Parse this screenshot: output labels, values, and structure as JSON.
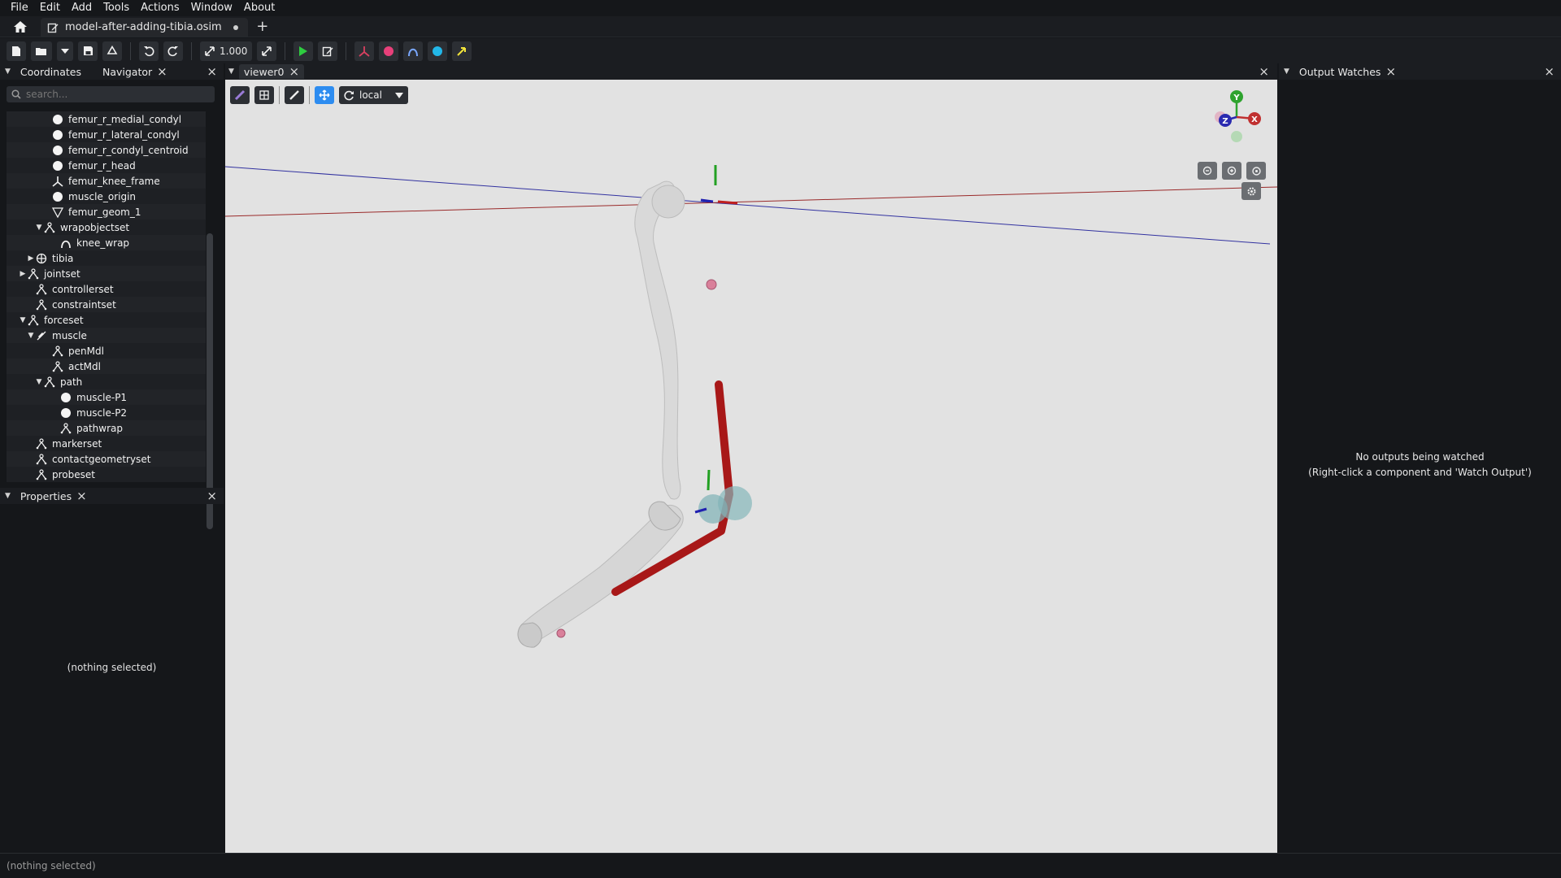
{
  "menu": [
    "File",
    "Edit",
    "Add",
    "Tools",
    "Actions",
    "Window",
    "About"
  ],
  "tabs": {
    "document_title": "model-after-adding-tibia.osim",
    "new_tab_symbol": "+"
  },
  "toolbar": {
    "scale_value": "1.000"
  },
  "navigator": {
    "coordinates_tab": "Coordinates",
    "navigator_tab": "Navigator",
    "search_placeholder": "search...",
    "tree": [
      {
        "label": "femur_r_medial_condyl",
        "indent": 5,
        "arrow": "",
        "icon": "circle"
      },
      {
        "label": "femur_r_lateral_condyl",
        "indent": 5,
        "arrow": "",
        "icon": "circle"
      },
      {
        "label": "femur_r_condyl_centroid",
        "indent": 5,
        "arrow": "",
        "icon": "circle"
      },
      {
        "label": "femur_r_head",
        "indent": 5,
        "arrow": "",
        "icon": "circle"
      },
      {
        "label": "femur_knee_frame",
        "indent": 5,
        "arrow": "",
        "icon": "frame"
      },
      {
        "label": "muscle_origin",
        "indent": 5,
        "arrow": "",
        "icon": "circle"
      },
      {
        "label": "femur_geom_1",
        "indent": 5,
        "arrow": "",
        "icon": "mesh"
      },
      {
        "label": "wrapobjectset",
        "indent": 4,
        "arrow": "down",
        "icon": "set"
      },
      {
        "label": "knee_wrap",
        "indent": 6,
        "arrow": "",
        "icon": "wrap"
      },
      {
        "label": "tibia",
        "indent": 3,
        "arrow": "right",
        "icon": "body"
      },
      {
        "label": "jointset",
        "indent": 2,
        "arrow": "right",
        "icon": "set"
      },
      {
        "label": "controllerset",
        "indent": 3,
        "arrow": "",
        "icon": "set"
      },
      {
        "label": "constraintset",
        "indent": 3,
        "arrow": "",
        "icon": "set"
      },
      {
        "label": "forceset",
        "indent": 2,
        "arrow": "down",
        "icon": "set"
      },
      {
        "label": "muscle",
        "indent": 3,
        "arrow": "down",
        "icon": "muscle"
      },
      {
        "label": "penMdl",
        "indent": 5,
        "arrow": "",
        "icon": "set"
      },
      {
        "label": "actMdl",
        "indent": 5,
        "arrow": "",
        "icon": "set"
      },
      {
        "label": "path",
        "indent": 4,
        "arrow": "down",
        "icon": "set"
      },
      {
        "label": "muscle-P1",
        "indent": 6,
        "arrow": "",
        "icon": "circle"
      },
      {
        "label": "muscle-P2",
        "indent": 6,
        "arrow": "",
        "icon": "circle"
      },
      {
        "label": "pathwrap",
        "indent": 6,
        "arrow": "",
        "icon": "set"
      },
      {
        "label": "markerset",
        "indent": 3,
        "arrow": "",
        "icon": "set"
      },
      {
        "label": "contactgeometryset",
        "indent": 3,
        "arrow": "",
        "icon": "set"
      },
      {
        "label": "probeset",
        "indent": 3,
        "arrow": "",
        "icon": "set"
      }
    ]
  },
  "properties": {
    "title": "Properties",
    "empty_text": "(nothing selected)"
  },
  "viewer": {
    "tab_label": "viewer0",
    "frame_mode": "local",
    "axes": {
      "x": "X",
      "y": "Y",
      "z": "Z"
    }
  },
  "output_watches": {
    "title": "Output Watches",
    "empty_line1": "No outputs being watched",
    "empty_line2": "(Right-click a component and 'Watch Output')"
  },
  "status": {
    "text": "(nothing selected)"
  },
  "colors": {
    "accent": "#2d8cf0",
    "play": "#2ecc40",
    "muscle": "#a01818",
    "bone": "#d8d8d8"
  }
}
